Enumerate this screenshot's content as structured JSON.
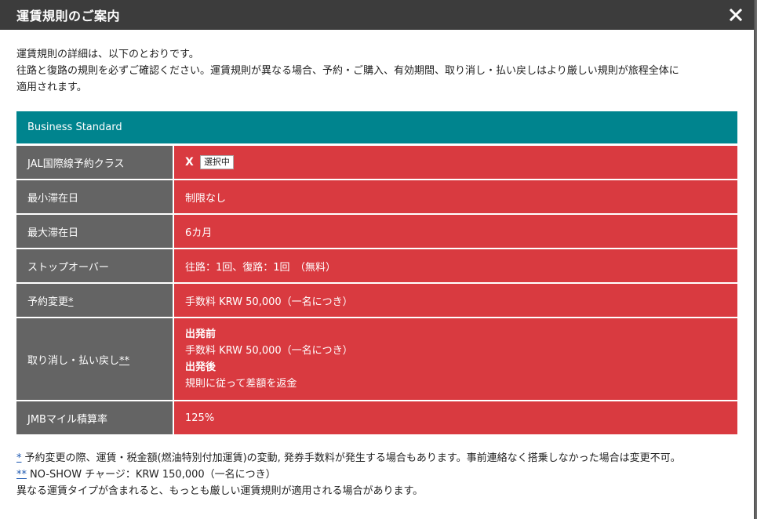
{
  "modal": {
    "title": "運賃規則のご案内",
    "close_icon": "close-icon"
  },
  "intro": {
    "line1": "運賃規則の詳細は、以下のとおりです。",
    "line2": "往路と復路の規則を必ずご確認ください。運賃規則が異なる場合、予約・ご購入、有効期間、取り消し・払い戻しはより厳しい規則が旅程全体に",
    "line3": "適用されます。"
  },
  "fare": {
    "name": "Business Standard",
    "rows": {
      "booking_class": {
        "label": "JAL国際線予約クラス",
        "code": "X",
        "badge": "選択中"
      },
      "min_stay": {
        "label": "最小滞在日",
        "value": "制限なし"
      },
      "max_stay": {
        "label": "最大滞在日",
        "value": "6カ月"
      },
      "stopover": {
        "label": "ストップオーバー",
        "value": "往路：1回、復路：1回　（無料）"
      },
      "change": {
        "label": "予約変更",
        "mark": "*",
        "value": "手数料 KRW 50,000（一名につき）"
      },
      "cancel": {
        "label": "取り消し・払い戻し",
        "mark": "**",
        "before_heading": "出発前",
        "before_value": "手数料 KRW 50,000（一名につき）",
        "after_heading": "出発後",
        "after_value": "規則に従って差額を返金"
      },
      "mileage": {
        "label": "JMBマイル積算率",
        "value": "125%"
      }
    }
  },
  "notes": {
    "note1_mark": "*",
    "note1_text": "予約変更の際、運賃・税金額(燃油特別付加運賃)の変動, 発券手数料が発生する場合もあります。事前連絡なく搭乗しなかった場合は変更不可。",
    "note2_mark": "**",
    "note2_text": "NO-SHOW チャージ：KRW 150,000（一名につき）",
    "note3_text": "異なる運賃タイプが含まれると、もっとも厳しい運賃規則が適用される場合があります。"
  },
  "colors": {
    "header_bg": "#3c3c3c",
    "fare_head_bg": "#00848e",
    "label_bg": "#646464",
    "value_bg": "#d93a40"
  }
}
